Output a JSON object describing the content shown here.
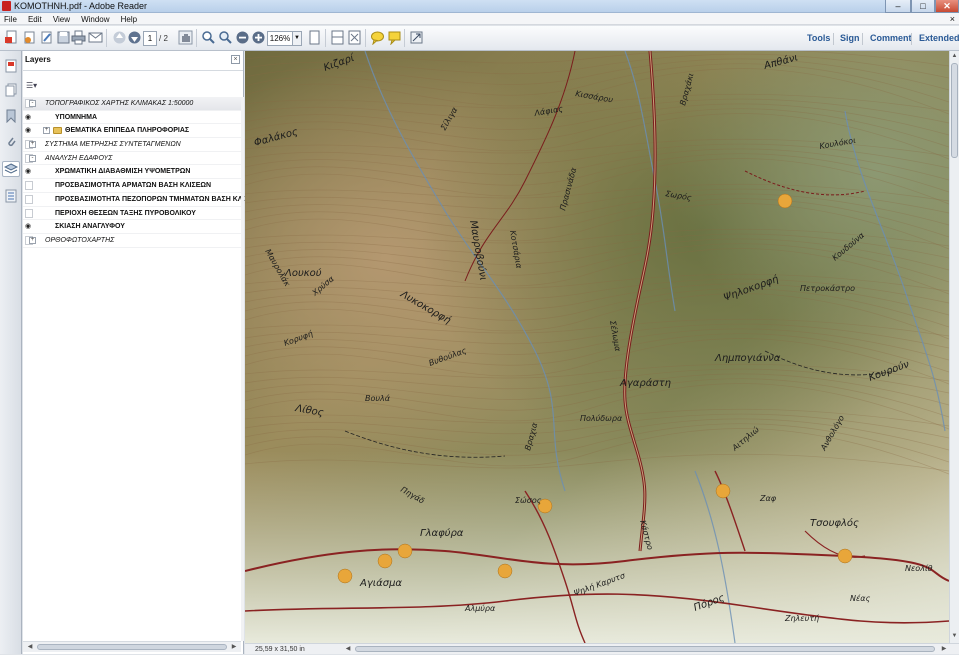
{
  "window": {
    "title": "KOMOTHNH.pdf - Adobe Reader",
    "min_label": "–",
    "max_label": "□",
    "close_label": "✕"
  },
  "menu": {
    "items": [
      "File",
      "Edit",
      "View",
      "Window",
      "Help"
    ],
    "close_label": "×"
  },
  "toolbar": {
    "page_current": "1",
    "page_total": "/ 2",
    "zoom": "126%",
    "right_links": [
      "Tools",
      "Sign",
      "Comment",
      "Extended"
    ]
  },
  "layers_panel": {
    "title": "Layers",
    "items": [
      {
        "label": "ΤΟΠΟΓΡΑΦΙΚΟΣ ΧΑΡΤΗΣ ΚΛΙΜΑΚΑΣ 1:50000",
        "level": 0,
        "toggle": "-",
        "visible": false,
        "style": "italic",
        "group": true
      },
      {
        "label": "ΥΠΟΜΝΗΜΑ",
        "level": 1,
        "toggle": "",
        "visible": true,
        "style": "bold",
        "group": false
      },
      {
        "label": "ΘΕΜΑΤΙΚΑ ΕΠΙΠΕΔΑ ΠΛΗΡΟΦΟΡΙΑΣ",
        "level": 1,
        "toggle": "+",
        "visible": true,
        "style": "bold",
        "group": false,
        "folder": true
      },
      {
        "label": "ΣΥΣΤΗΜΑ ΜΕΤΡΗΣΗΣ ΣΥΝΤΕΤΑΓΜΕΝΩΝ",
        "level": 0,
        "toggle": "+",
        "visible": false,
        "style": "italic",
        "group": false
      },
      {
        "label": "ΑΝΑΛΥΣΗ ΕΔΑΦΟΥΣ",
        "level": 0,
        "toggle": "-",
        "visible": false,
        "style": "italic",
        "group": false
      },
      {
        "label": "ΧΡΩΜΑΤΙΚΗ ΔΙΑΒΑΘΜΙΣΗ ΥΨΟΜΕΤΡΩΝ",
        "level": 1,
        "toggle": "",
        "visible": true,
        "style": "bold",
        "group": false
      },
      {
        "label": "ΠΡΟΣΒΑΣΙΜΟΤΗΤΑ ΑΡΜΑΤΩΝ ΒΑΣΗ ΚΛΙΣΕΩΝ",
        "level": 1,
        "toggle": "",
        "visible": false,
        "style": "bold",
        "group": false
      },
      {
        "label": "ΠΡΟΣΒΑΣΙΜΟΤΗΤΑ ΠΕΖΟΠΟΡΩΝ ΤΜΗΜΑΤΩΝ ΒΑΣΗ ΚΛΙΣΕΩΝ",
        "level": 1,
        "toggle": "",
        "visible": false,
        "style": "bold",
        "group": false
      },
      {
        "label": "ΠΕΡΙΟΧΗ ΘΕΣΕΩΝ ΤΑΞΗΣ ΠΥΡΟΒΟΛΙΚΟΥ",
        "level": 1,
        "toggle": "",
        "visible": false,
        "style": "bold",
        "group": false
      },
      {
        "label": "ΣΚΙΑΣΗ ΑΝΑΓΛΥΦΟΥ",
        "level": 1,
        "toggle": "",
        "visible": true,
        "style": "bold",
        "group": false
      },
      {
        "label": "ΟΡΘΟΦΩΤΟΧΑΡΤΗΣ",
        "level": 0,
        "toggle": "+",
        "visible": false,
        "style": "italic",
        "group": false
      }
    ]
  },
  "status": {
    "page_dimensions": "25,59 x 31,50 in"
  },
  "map": {
    "labels": [
      {
        "text": "Κιζαρί",
        "rotate": -20
      },
      {
        "text": "Κισσάρου",
        "rotate": 10
      },
      {
        "text": "Βραχάκι",
        "rotate": -75
      },
      {
        "text": "Απθάνι",
        "rotate": -15
      },
      {
        "text": "Σίλιγα",
        "rotate": -60
      },
      {
        "text": "Λάφιας",
        "rotate": -10
      },
      {
        "text": "Φαλάκος",
        "rotate": -15
      },
      {
        "text": "Κουλόκοι",
        "rotate": -10
      },
      {
        "text": "Σωρός",
        "rotate": 10
      },
      {
        "text": "Μαυροβούνι",
        "rotate": 80
      },
      {
        "text": "Κοτσάρια",
        "rotate": 80
      },
      {
        "text": "Πρασινάδα",
        "rotate": -75
      },
      {
        "text": "Λουκού",
        "rotate": 0
      },
      {
        "text": "Μαυρολάκ",
        "rotate": 60
      },
      {
        "text": "Χρύσα",
        "rotate": -40
      },
      {
        "text": "Λυκοκορφή",
        "rotate": 30
      },
      {
        "text": "Κορυφή",
        "rotate": -20
      },
      {
        "text": "Σέλωμα",
        "rotate": 80
      },
      {
        "text": "Ψηλοκορφή",
        "rotate": -20
      },
      {
        "text": "Πετροκάστρο",
        "rotate": 0
      },
      {
        "text": "Κουδούνα",
        "rotate": -40
      },
      {
        "text": "Λημπογιάννα",
        "rotate": 0
      },
      {
        "text": "Βυθούλας",
        "rotate": -20
      },
      {
        "text": "Βουλά",
        "rotate": 0
      },
      {
        "text": "Αγαράστη",
        "rotate": 0
      },
      {
        "text": "Βραχια",
        "rotate": -75
      },
      {
        "text": "Πολύδωρα",
        "rotate": 0
      },
      {
        "text": "Κουρούν",
        "rotate": -20
      },
      {
        "text": "Αιτηλιώ",
        "rotate": -40
      },
      {
        "text": "Ανθολόγο",
        "rotate": -60
      },
      {
        "text": "Λίθος",
        "rotate": 10
      },
      {
        "text": "Πηγάδ",
        "rotate": 30
      },
      {
        "text": "Σώσος",
        "rotate": 0
      },
      {
        "text": "Γλαφύρα",
        "rotate": 0
      },
      {
        "text": "Κάστρο",
        "rotate": 75
      },
      {
        "text": "Ζαφ",
        "rotate": 0
      },
      {
        "text": "Αγιάσμα",
        "rotate": 0
      },
      {
        "text": "Αλμύρα",
        "rotate": 0
      },
      {
        "text": "Ψηλή Καρυτσ",
        "rotate": -20
      },
      {
        "text": "Τσουφλός",
        "rotate": 0
      },
      {
        "text": "Νέας",
        "rotate": 0
      },
      {
        "text": "Νεολίθ",
        "rotate": 0
      },
      {
        "text": "Πόρος",
        "rotate": -20
      },
      {
        "text": "Ζηλευτή",
        "rotate": 0
      }
    ]
  }
}
